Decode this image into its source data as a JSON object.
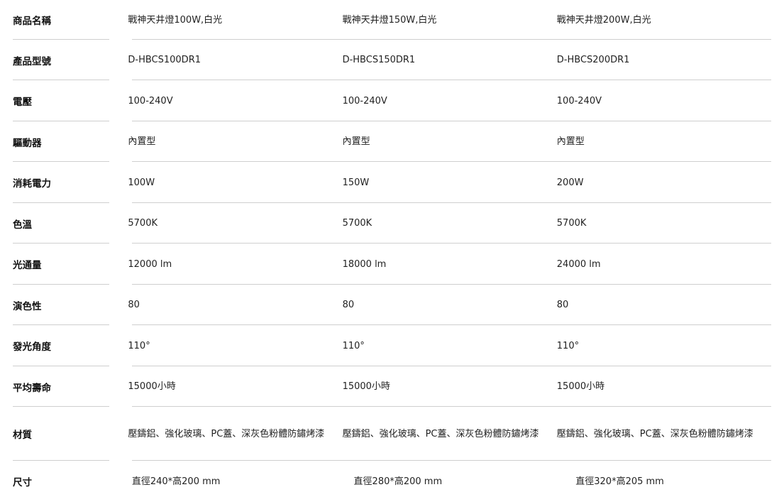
{
  "spec_table": {
    "columns": [
      "product_1",
      "product_2",
      "product_3"
    ],
    "rows": [
      {
        "label": "商品名稱",
        "values": [
          "戰神天井燈100W,白光",
          "戰神天井燈150W,白光",
          "戰神天井燈200W,白光"
        ]
      },
      {
        "label": "產品型號",
        "values": [
          "D-HBCS100DR1",
          "D-HBCS150DR1",
          "D-HBCS200DR1"
        ]
      },
      {
        "label": "電壓",
        "values": [
          "100-240V",
          "100-240V",
          "100-240V"
        ]
      },
      {
        "label": "驅動器",
        "values": [
          "內置型",
          "內置型",
          "內置型"
        ]
      },
      {
        "label": "消耗電力",
        "values": [
          "100W",
          "150W",
          "200W"
        ]
      },
      {
        "label": "色溫",
        "values": [
          "5700K",
          "5700K",
          "5700K"
        ]
      },
      {
        "label": "光通量",
        "values": [
          "12000 lm",
          "18000 lm",
          "24000 lm"
        ]
      },
      {
        "label": "演色性",
        "values": [
          "80",
          "80",
          "80"
        ]
      },
      {
        "label": "發光角度",
        "values": [
          "110°",
          "110°",
          "110°"
        ]
      },
      {
        "label": "平均壽命",
        "values": [
          "15000小時",
          "15000小時",
          "15000小時"
        ]
      },
      {
        "label": "材質",
        "values": [
          "壓鑄鋁、強化玻璃、PC蓋、深灰色粉體防鏽烤漆",
          "壓鑄鋁、強化玻璃、PC蓋、深灰色粉體防鏽烤漆",
          "壓鑄鋁、強化玻璃、PC蓋、深灰色粉體防鏽烤漆"
        ]
      },
      {
        "label": "尺寸",
        "values": [
          "直徑240*高200 mm",
          "直徑280*高200 mm",
          "直徑320*高205 mm"
        ]
      }
    ]
  },
  "colors": {
    "text": "#222222",
    "label_text": "#111111",
    "divider": "#cfcfcf",
    "background": "#ffffff"
  }
}
